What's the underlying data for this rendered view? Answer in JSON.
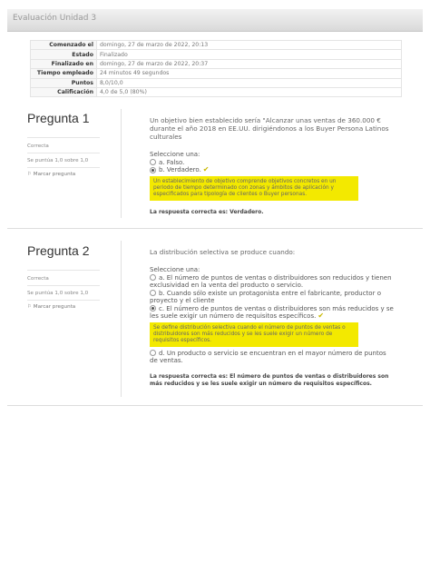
{
  "header": {
    "title": "Evaluación Unidad 3"
  },
  "summary": [
    {
      "label": "Comenzado el",
      "value": "domingo, 27 de marzo de 2022, 20:13"
    },
    {
      "label": "Estado",
      "value": "Finalizado"
    },
    {
      "label": "Finalizado en",
      "value": "domingo, 27 de marzo de 2022, 20:37"
    },
    {
      "label": "Tiempo empleado",
      "value": "24 minutos 49 segundos"
    },
    {
      "label": "Puntos",
      "value": "8,0/10,0"
    },
    {
      "label": "Calificación",
      "value": "4,0 de 5,0 (80%)"
    }
  ],
  "questions": [
    {
      "title": "Pregunta 1",
      "status": "Correcta",
      "score": "Se puntúa 1,0 sobre 1,0",
      "flag": "Marcar pregunta",
      "text": "Un objetivo bien establecido sería \"Alcanzar unas ventas de 360.000 € durante el año 2018 en EE.UU. dirigiéndonos a los Buyer Persona Latinos culturales",
      "prompt": "Seleccione una:",
      "options": [
        "a. Falso.",
        "b. Verdadero."
      ],
      "feedback": "Un establecimiento de objetivo comprende objetivos concretos en un periodo de tiempo determinado con zonas y ámbitos de aplicación y especificados para tipología de clientes o Buyer personas.",
      "correct_answer": "La respuesta correcta es: Verdadero."
    },
    {
      "title": "Pregunta 2",
      "status": "Correcta",
      "score": "Se puntúa 1,0 sobre 1,0",
      "flag": "Marcar pregunta",
      "text": "La distribución selectiva se produce cuando:",
      "prompt": "Seleccione una:",
      "options": [
        "a. El número de puntos de ventas o distribuidores son reducidos y tienen exclusividad en la venta del producto o servicio.",
        "b. Cuando sólo existe un protagonista entre el fabricante, productor o proyecto y el cliente",
        "c. El número de puntos de ventas o distribuidores son más reducidos y se les suele exigir un número de requisitos específicos.",
        "d. Un producto o servicio se encuentran en el mayor número de puntos de ventas."
      ],
      "feedback": "Se define distribución selectiva cuando el número de puntos de ventas o distribuidores son más reducidos y se les suele exigir un número de requisitos específicos.",
      "correct_answer": "La respuesta correcta es: El número de puntos de ventas o distribuidores son más reducidos y se les suele exigir un número de requisitos específicos."
    }
  ]
}
